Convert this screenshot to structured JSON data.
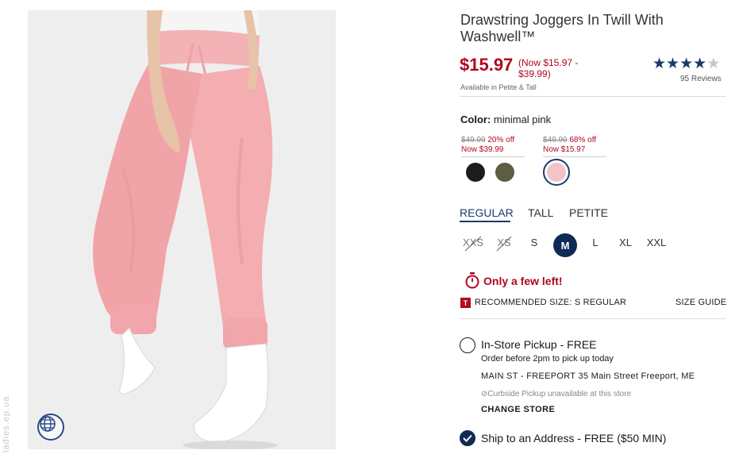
{
  "product": {
    "title": "Drawstring Joggers In Twill With Washwell™",
    "price_now": "$15.97",
    "price_range": "(Now $15.97 - $39.99)",
    "availability": "Available in Petite & Tall",
    "rating": 4,
    "rating_max": 5,
    "reviews": "95 Reviews"
  },
  "color": {
    "label": "Color:",
    "value": "minimal pink",
    "groups": [
      {
        "old_price": "$49.99",
        "discount": "20% off",
        "now": "Now $39.99"
      },
      {
        "old_price": "$49.99",
        "discount": "68% off",
        "now": "Now $15.97"
      }
    ],
    "swatches": [
      {
        "name": "black",
        "hex": "#1c1c1c"
      },
      {
        "name": "olive",
        "hex": "#5c5d44"
      },
      {
        "name": "minimal pink",
        "hex": "#f2c3c8"
      }
    ]
  },
  "fit": {
    "tabs": [
      "REGULAR",
      "TALL",
      "PETITE"
    ],
    "selected": "REGULAR"
  },
  "sizes": {
    "items": [
      "XXS",
      "XS",
      "S",
      "M",
      "L",
      "XL",
      "XXL"
    ],
    "unavailable": [
      "XXS",
      "XS"
    ],
    "selected": "M"
  },
  "stock": {
    "message": "Only a few left!"
  },
  "recommendation": {
    "badge": "T",
    "text": "RECOMMENDED SIZE: S REGULAR",
    "size_guide": "SIZE GUIDE"
  },
  "fulfillment": {
    "pickup": {
      "title": "In-Store Pickup - FREE",
      "note": "Order before 2pm to pick up today",
      "store": "MAIN ST - FREEPORT 35 Main Street  Freeport, ME",
      "curbside": "Curbside Pickup unavailable at this store",
      "change_store": "CHANGE STORE"
    },
    "ship": {
      "title": "Ship to an Address - FREE ($50 MIN)"
    }
  },
  "image": {
    "watermark": "ladies.ep.ua"
  },
  "colors": {
    "sale_red": "#b1071f",
    "navy": "#0f2a55",
    "pant_pink": "#f0a9ad"
  }
}
